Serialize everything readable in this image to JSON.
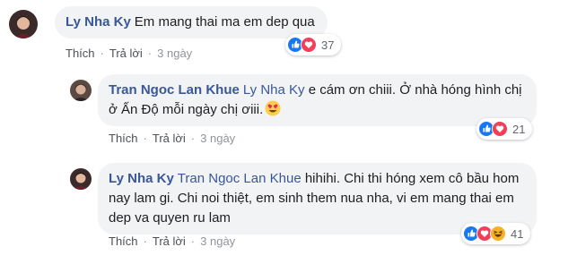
{
  "comments": [
    {
      "author": "Ly Nha Ky",
      "mention": "",
      "text": "Em mang thai ma em dep qua",
      "like_label": "Thích",
      "reply_label": "Trả lời",
      "time": "3 ngày",
      "reaction_icons": [
        "like-icon",
        "love-icon"
      ],
      "reaction_count": "37"
    },
    {
      "author": "Tran Ngoc Lan Khue",
      "mention": "Ly Nha Ky",
      "text": "e cám ơn chiii. Ở nhà hóng hình chị ở Ấn Độ mỗi ngày chị ơiii.",
      "emoji": "heart-eyes-emoji",
      "like_label": "Thích",
      "reply_label": "Trả lời",
      "time": "3 ngày",
      "reaction_icons": [
        "like-icon",
        "love-icon"
      ],
      "reaction_count": "21"
    },
    {
      "author": "Ly Nha Ky",
      "mention": "Tran Ngoc Lan Khue",
      "text": "hihihi. Chi thi hóng xem cô bầu hom nay lam gi. Chi noi thiệt, em sinh them nua nha, vi em mang thai em dep va quyen ru lam",
      "like_label": "Thích",
      "reply_label": "Trả lời",
      "time": "3 ngày",
      "reaction_icons": [
        "like-icon",
        "love-icon",
        "haha-icon"
      ],
      "reaction_count": "41"
    }
  ],
  "colors": {
    "name_link": "#385898",
    "bubble_bg": "#f2f3f5",
    "like_blue": "#1877f2",
    "love_red": "#f33e58",
    "haha_yellow": "#f7b125"
  }
}
